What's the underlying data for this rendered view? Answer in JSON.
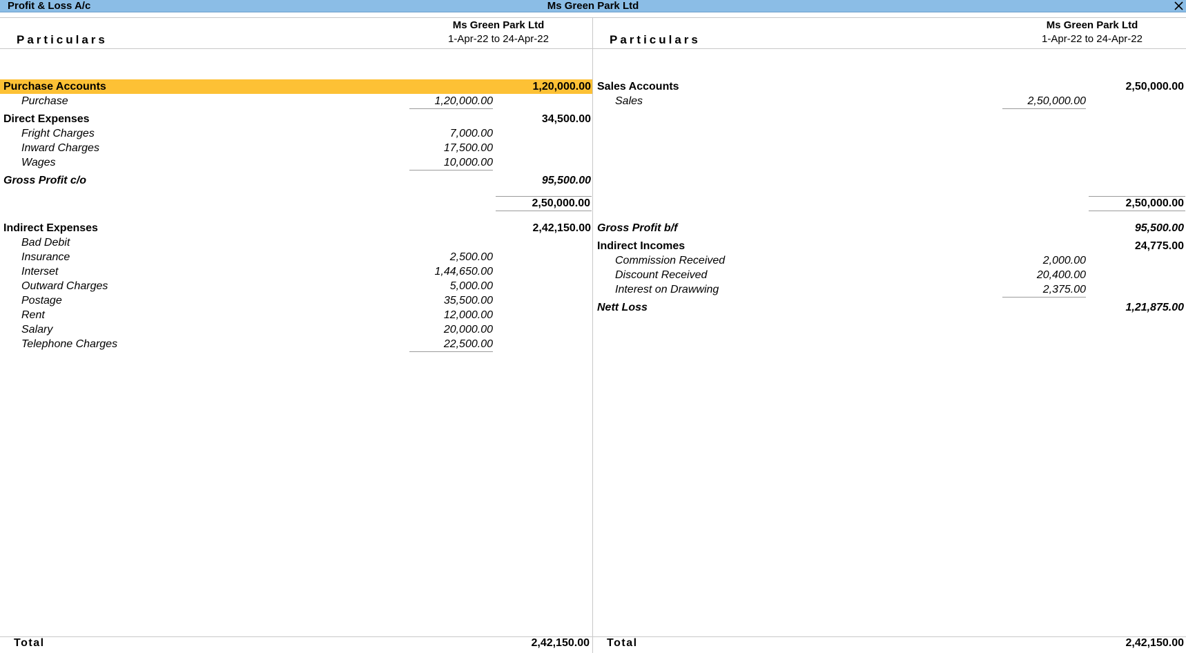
{
  "window": {
    "report_title": "Profit & Loss A/c",
    "company_title": "Ms Green Park Ltd"
  },
  "icons": {
    "close": "close-icon"
  },
  "colors": {
    "titlebar": "#8bbde6",
    "selected_row": "#fdc135"
  },
  "columns": {
    "left": {
      "particulars_label": "Particulars",
      "company": "Ms Green Park Ltd",
      "period": "1-Apr-22 to 24-Apr-22"
    },
    "right": {
      "particulars_label": "Particulars",
      "company": "Ms Green Park Ltd",
      "period": "1-Apr-22 to 24-Apr-22"
    }
  },
  "left": {
    "purchase_accounts": {
      "name": "Purchase Accounts",
      "amount": "1,20,000.00",
      "items": [
        {
          "name": "Purchase",
          "amount": "1,20,000.00"
        }
      ]
    },
    "direct_expenses": {
      "name": "Direct Expenses",
      "amount": "34,500.00",
      "items": [
        {
          "name": "Fright Charges",
          "amount": "7,000.00"
        },
        {
          "name": "Inward Charges",
          "amount": "17,500.00"
        },
        {
          "name": "Wages",
          "amount": "10,000.00"
        }
      ]
    },
    "gross_profit_co": {
      "name": "Gross Profit c/o",
      "amount": "95,500.00"
    },
    "subtotal": "2,50,000.00",
    "indirect_expenses": {
      "name": "Indirect Expenses",
      "amount": "2,42,150.00",
      "items": [
        {
          "name": "Bad Debit",
          "amount": ""
        },
        {
          "name": "Insurance",
          "amount": "2,500.00"
        },
        {
          "name": "Interset",
          "amount": "1,44,650.00"
        },
        {
          "name": "Outward Charges",
          "amount": "5,000.00"
        },
        {
          "name": "Postage",
          "amount": "35,500.00"
        },
        {
          "name": "Rent",
          "amount": "12,000.00"
        },
        {
          "name": "Salary",
          "amount": "20,000.00"
        },
        {
          "name": "Telephone Charges",
          "amount": "22,500.00"
        }
      ]
    },
    "total_label": "Total",
    "total": "2,42,150.00"
  },
  "right": {
    "sales_accounts": {
      "name": "Sales Accounts",
      "amount": "2,50,000.00",
      "items": [
        {
          "name": "Sales",
          "amount": "2,50,000.00"
        }
      ]
    },
    "subtotal": "2,50,000.00",
    "gross_profit_bf": {
      "name": "Gross Profit b/f",
      "amount": "95,500.00"
    },
    "indirect_incomes": {
      "name": "Indirect Incomes",
      "amount": "24,775.00",
      "items": [
        {
          "name": "Commission Received",
          "amount": "2,000.00"
        },
        {
          "name": "Discount Received",
          "amount": "20,400.00"
        },
        {
          "name": "Interest on Drawwing",
          "amount": "2,375.00"
        }
      ]
    },
    "nett_loss": {
      "name": "Nett Loss",
      "amount": "1,21,875.00"
    },
    "total_label": "Total",
    "total": "2,42,150.00"
  }
}
